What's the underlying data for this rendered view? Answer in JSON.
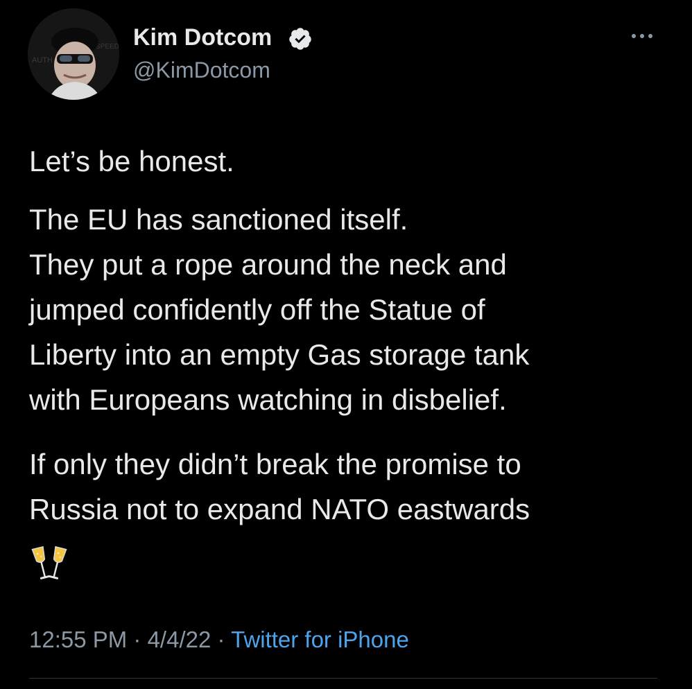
{
  "author": {
    "name": "Kim Dotcom",
    "handle": "@KimDotcom",
    "verified": true,
    "avatar_icon": "profile-photo-avatar"
  },
  "tweet": {
    "paragraphs": [
      [
        "Let’s be honest."
      ],
      [
        "The EU has sanctioned itself.",
        "They put a rope around the neck and",
        "jumped confidently off the Statue of",
        "Liberty into an empty Gas storage tank",
        "with Europeans watching in disbelief."
      ],
      [
        "If only they didn’t break the promise to",
        "Russia not to expand NATO eastwards"
      ]
    ],
    "emoji": "clinking-glasses-icon"
  },
  "meta": {
    "time": "12:55 PM",
    "sep1": " · ",
    "date": "4/4/22",
    "sep2": " · ",
    "source": "Twitter for iPhone"
  },
  "icons": {
    "verified": "verified-badge-icon",
    "more": "more-options-icon"
  },
  "colors": {
    "background": "#000000",
    "text": "#e7e9ea",
    "secondary": "#8b98a5",
    "link": "#4ea4ec",
    "divider": "#2f3336"
  }
}
